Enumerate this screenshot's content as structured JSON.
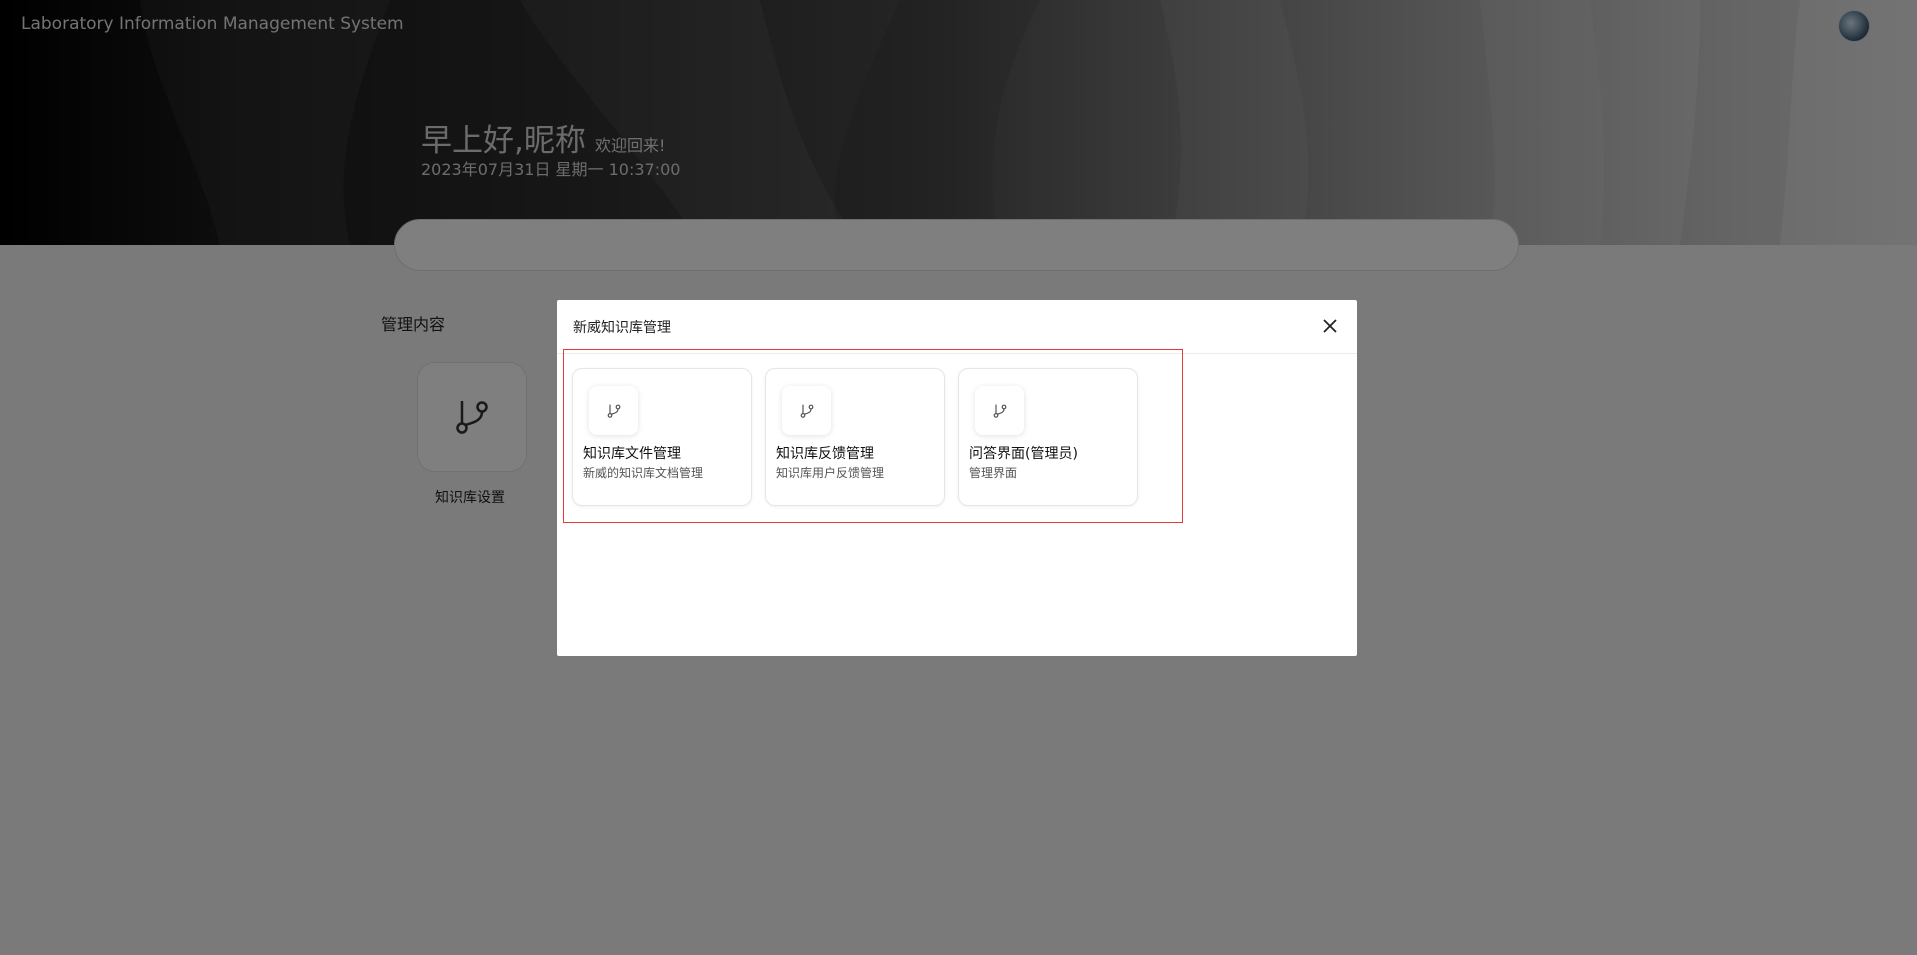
{
  "header": {
    "app_title": "Laboratory Information Management System",
    "greeting_main": "早上好,昵称",
    "greeting_sub": "欢迎回来!",
    "datetime": "2023年07月31日 星期一 10:37:00"
  },
  "section": {
    "title": "管理内容",
    "items": [
      {
        "label": "知识库设置",
        "icon": "git-branch-icon"
      }
    ]
  },
  "modal": {
    "title": "新威知识库管理",
    "close_icon": "close-icon",
    "cards": [
      {
        "title": "知识库文件管理",
        "desc": "新威的知识库文档管理",
        "icon": "git-branch-icon"
      },
      {
        "title": "知识库反馈管理",
        "desc": "知识库用户反馈管理",
        "icon": "git-branch-icon"
      },
      {
        "title": "问答界面(管理员)",
        "desc": "管理界面",
        "icon": "git-branch-icon"
      }
    ]
  },
  "colors": {
    "highlight_border": "#e53935",
    "overlay": "rgba(0,0,0,0.5)"
  }
}
